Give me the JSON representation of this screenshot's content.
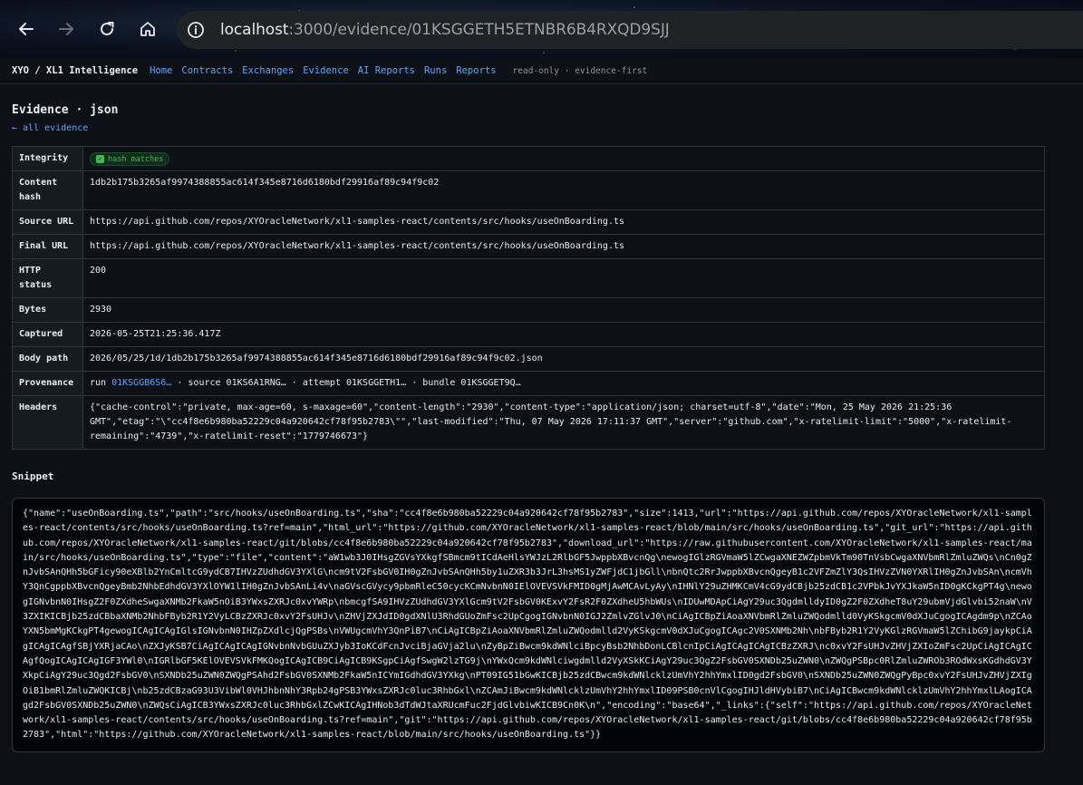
{
  "browser": {
    "url_host": "localhost",
    "url_rest": ":3000/evidence/01KSGGETH5ETNBR6B4RXQD9SJJ"
  },
  "nav": {
    "brand": "XYO / XL1 Intelligence",
    "links": [
      "Home",
      "Contracts",
      "Exchanges",
      "Evidence",
      "AI Reports",
      "Runs",
      "Reports"
    ],
    "note": "read-only · evidence-first"
  },
  "page": {
    "title": "Evidence · json",
    "back": "← all evidence"
  },
  "meta": {
    "integrity_label": "Integrity",
    "integrity_badge": "hash matches",
    "content_hash_label": "Content hash",
    "content_hash": "1db2b175b3265af9974388855ac614f345e8716d6180bdf29916af89c94f9c02",
    "source_url_label": "Source URL",
    "source_url": "https://api.github.com/repos/XYOracleNetwork/xl1-samples-react/contents/src/hooks/useOnBoarding.ts",
    "final_url_label": "Final URL",
    "final_url": "https://api.github.com/repos/XYOracleNetwork/xl1-samples-react/contents/src/hooks/useOnBoarding.ts",
    "http_status_label": "HTTP status",
    "http_status": "200",
    "bytes_label": "Bytes",
    "bytes": "2930",
    "captured_label": "Captured",
    "captured": "2026-05-25T21:25:36.417Z",
    "body_path_label": "Body path",
    "body_path": "2026/05/25/1d/1db2b175b3265af9974388855ac614f345e8716d6180bdf29916af89c94f9c02.json",
    "provenance_label": "Provenance",
    "prov_run_prefix": "run",
    "prov_run": "01KSGGB6S6…",
    "prov_source": "· source 01KS6A1RNG… · attempt 01KSGGETH1… · bundle 01KSGGET9Q…",
    "headers_label": "Headers",
    "headers": "{\"cache-control\":\"private, max-age=60, s-maxage=60\",\"content-length\":\"2930\",\"content-type\":\"application/json; charset=utf-8\",\"date\":\"Mon, 25 May 2026 21:25:36 GMT\",\"etag\":\"\\\"cc4f8e6b980ba52229c04a920642cf78f95b2783\\\"\",\"last-modified\":\"Thu, 07 May 2026 17:11:37 GMT\",\"server\":\"github.com\",\"x-ratelimit-limit\":\"5000\",\"x-ratelimit-remaining\":\"4739\",\"x-ratelimit-reset\":\"1779746673\"}"
  },
  "snippet": {
    "heading": "Snippet",
    "body": "{\"name\":\"useOnBoarding.ts\",\"path\":\"src/hooks/useOnBoarding.ts\",\"sha\":\"cc4f8e6b980ba52229c04a920642cf78f95b2783\",\"size\":1413,\"url\":\"https://api.github.com/repos/XYOracleNetwork/xl1-samples-react/contents/src/hooks/useOnBoarding.ts?ref=main\",\"html_url\":\"https://github.com/XYOracleNetwork/xl1-samples-react/blob/main/src/hooks/useOnBoarding.ts\",\"git_url\":\"https://api.github.com/repos/XYOracleNetwork/xl1-samples-react/git/blobs/cc4f8e6b980ba52229c04a920642cf78f95b2783\",\"download_url\":\"https://raw.githubusercontent.com/XYOracleNetwork/xl1-samples-react/main/src/hooks/useOnBoarding.ts\",\"type\":\"file\",\"content\":\"aW1wb3J0IHsgZGVsYXkgfSBmcm9tICdAeHlsYWJzL2RlbGF5JwppbXBvcnQg\\newogIGlzRGVmaW5lZCwgaXNEZWZpbmVkTm90TnVsbCwgaXNVbmRlZmluZWQs\\nCn0gZnJvbSAnQHh5bGFicy90eXBlb2YnCmltcG9ydCB7IHVzZUdhdGV3YXlG\\ncm9tV2FsbGV0IH0gZnJvbSAnQHh5by1uZXR3b3JrL3hsMS1yZWFjdC1jbGll\\nbnQtc2RrJwppbXBvcnQgeyB1c2VFZmZlY3QsIHVzZVN0YXRlIH0gZnJvbSAn\\ncmVhY3QnCgppbXBvcnQgeyBmb2NhbEdhdGV3YXlOYW1lIH0gZnJvbSAnLi4v\\naGVscGVycy9pbmRleC50cycKCmNvbnN0IElOVEVSVkFMID0gMjAwMCAvLyAy\\nIHNlY29uZHMKCmV4cG9ydCBjb25zdCB1c2VPbkJvYXJkaW5nID0gKCkgPT4g\\newogIGNvbnN0IHsgZ2F0ZXdheSwgaXNMb2FkaW5nOiB3YWxsZXRJc0xvYWRp\\nbmcgfSA9IHVzZUdhdGV3YXlGcm9tV2FsbGV0KExvY2FsR2F0ZXdheU5hbWUs\\nIDUwMDApCiAgY29uc3QgdmlldyID0gZ2F0ZXdheT8uY29ubmVjdGlvbi52naW\\nV3ZXIKICBjb25zdCBbaXNMb2NhbFByb2R1Y2VyLCBzZXRJc0xvY2FsUHJv\\nZHVjZXJdID0gdXNlU3RhdGUoZmFsc2UpCgogIGNvbnN0IGJ2ZmlvZGlvJ0\\nCiAgICBpZiAoaXNVbmRlZmluZWQodmlld0VyKSkgcmV0dXJuCgogICAgdm9p\\nZCAoYXN5bmMgKCkgPT4gewogICAgICAgIGlsIGNvbnN0IHZpZXdlcjQgPSBs\\nVWUgcmVhY3QnPiB7\\nCiAgICBpZiAoaXNVbmRlZmluZWQodmlld2VyKSkgcmV0dXJuCgogICAgc2V0SXNMb2Nh\\nbFByb2R1Y2VyKGlzRGVmaW5lZChibG9jaykpCiAgICAgICAgfSBjYXRjaCAo\\nZXJyKSB7CiAgICAgICAgIGNvbnNvbGUuZXJyb3IoKCdFcnJvciBjaGVja2lu\\nZyBpZiBwcm9kdWNlciBpcyBsb2NhbDonLCBlcnIpCiAgICAgICAgICBzZXRJ\\nc0xvY2FsUHJvZHVjZXIoZmFsc2UpCiAgICAgICAgfQogICAgICAgIGF3YWl0\\nIGRlbGF5KElOVEVSVkFMKQogICAgICB9CiAgICB9KSgpCiAgfSwgW2lzTG9j\\nYWxQcm9kdWNlciwgdmlld2VyXSkKCiAgY29uc3QgZ2FsbGV0SXNDb25uZWN0\\nZWQgPSBpc0RlZmluZWROb3ROdWxsKGdhdGV3YXkpCiAgY29uc3Qgd2FsbGV0\\nSXNDb25uZWN0ZWQgPSAhd2FsbGV0SXNMb2FkaW5nICYmIGdhdGV3YXkg\\nPT09IG51bGwKICBjb25zdCBwcm9kdWNlcklzUmVhY2hhYmxlID0gd2FsbGV0\\nSXNDb25uZWN0ZWQgPyBpc0xvY2FsUHJvZHVjZXIgOiB1bmRlZmluZWQKICBj\\nb25zdCBzaG93U3VibWl0VHJhbnNhY3Rpb24gPSB3YWxsZXRJc0luc3RhbGxl\\nZCAmJiBwcm9kdWNlcklzUmVhY2hhYmxlID09PSB0cnVlCgogIHJldHVybiB7\\nCiAgICBwcm9kdWNlcklzUmVhY2hhYmxlLAogICAgd2FsbGV0SXNDb25uZWN0\\nZWQsCiAgICB3YWxsZXRJc0luc3RhbGxlZCwKICAgIHNob3dTdWJtaXRUcmFuc2FjdGlvbiwKICB9Cn0K\\n\",\"encoding\":\"base64\",\"_links\":{\"self\":\"https://api.github.com/repos/XYOracleNetwork/xl1-samples-react/contents/src/hooks/useOnBoarding.ts?ref=main\",\"git\":\"https://api.github.com/repos/XYOracleNetwork/xl1-samples-react/git/blobs/cc4f8e6b980ba52229c04a920642cf78f95b2783\",\"html\":\"https://github.com/XYOracleNetwork/xl1-samples-react/blob/main/src/hooks/useOnBoarding.ts\"}}"
  },
  "icons": {
    "back": "arrow-left-icon",
    "forward": "arrow-right-icon",
    "reload": "reload-icon",
    "home": "home-icon",
    "info": "info-icon",
    "check": "check-icon"
  },
  "colors": {
    "link": "#58a6ff",
    "success": "#3fb950",
    "background": "#0d1117"
  }
}
